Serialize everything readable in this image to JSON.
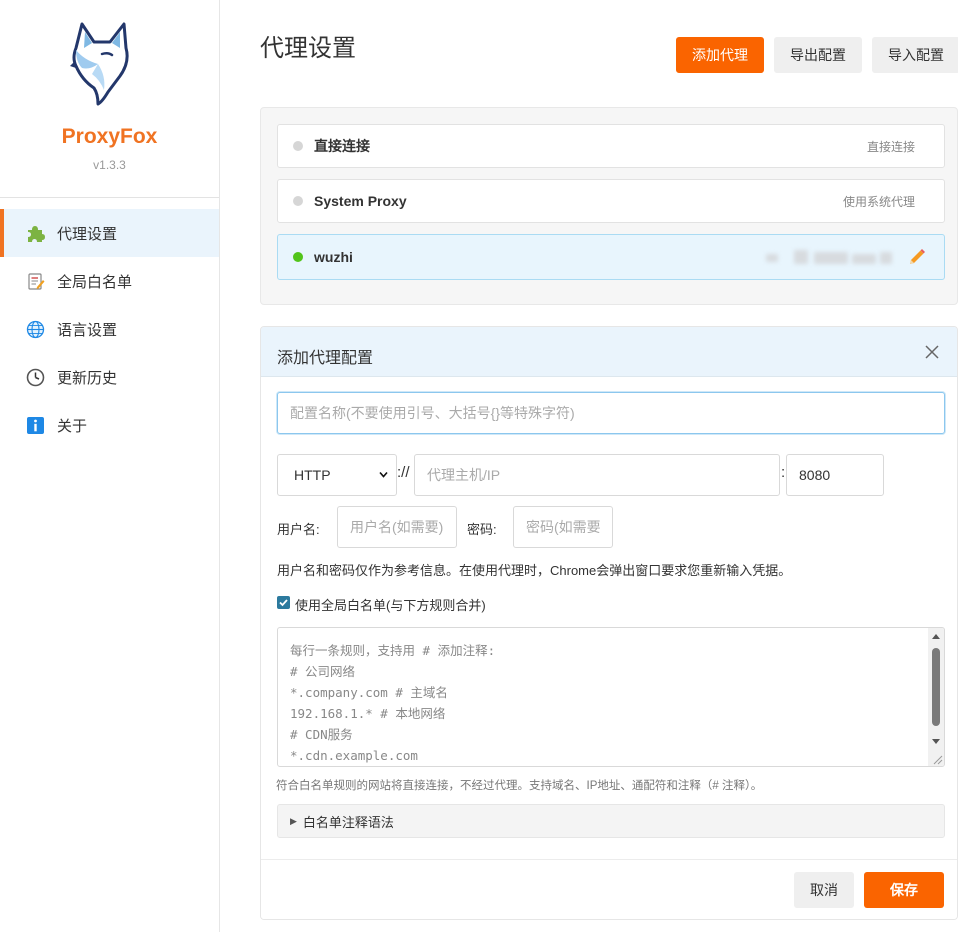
{
  "app": {
    "name": "ProxyFox",
    "version": "v1.3.3"
  },
  "sidebar": {
    "items": [
      {
        "label": "代理设置",
        "icon": "puzzle-icon"
      },
      {
        "label": "全局白名单",
        "icon": "notepad-icon"
      },
      {
        "label": "语言设置",
        "icon": "globe-icon"
      },
      {
        "label": "更新历史",
        "icon": "clock-icon"
      },
      {
        "label": "关于",
        "icon": "info-icon"
      }
    ],
    "active_index": 0
  },
  "header": {
    "title": "代理设置",
    "add_label": "添加代理",
    "export_label": "导出配置",
    "import_label": "导入配置"
  },
  "proxies": [
    {
      "name": "直接连接",
      "desc": "直接连接",
      "active": false
    },
    {
      "name": "System Proxy",
      "desc": "使用系统代理",
      "active": false
    },
    {
      "name": "wuzhi",
      "desc": "",
      "active": true
    }
  ],
  "form": {
    "title": "添加代理配置",
    "name_placeholder": "配置名称(不要使用引号、大括号{}等特殊字符)",
    "protocol": "HTTP",
    "scheme_sep": "://",
    "host_placeholder": "代理主机/IP",
    "port_sep": ":",
    "port": "8080",
    "username_label": "用户名:",
    "username_placeholder": "用户名(如需要)",
    "password_label": "密码:",
    "password_placeholder": "密码(如需要",
    "auth_hint": "用户名和密码仅作为参考信息。在使用代理时，Chrome会弹出窗口要求您重新输入凭据。",
    "whitelist_checkbox": "使用全局白名单(与下方规则合并)",
    "whitelist_checked": true,
    "rules_placeholder": "每行一条规则，支持用 # 添加注释:\n# 公司网络\n*.company.com # 主域名\n192.168.1.* # 本地网络\n# CDN服务\n*.cdn.example.com",
    "rules_note": "符合白名单规则的网站将直接连接，不经过代理。支持域名、IP地址、通配符和注释（# 注释）。",
    "syntax_summary": "白名单注释语法",
    "cancel_label": "取消",
    "save_label": "保存"
  },
  "colors": {
    "accent": "#fa6400",
    "brand": "#f07322",
    "active_dot": "#52c41a",
    "selected_bg": "#e8f5fd"
  }
}
